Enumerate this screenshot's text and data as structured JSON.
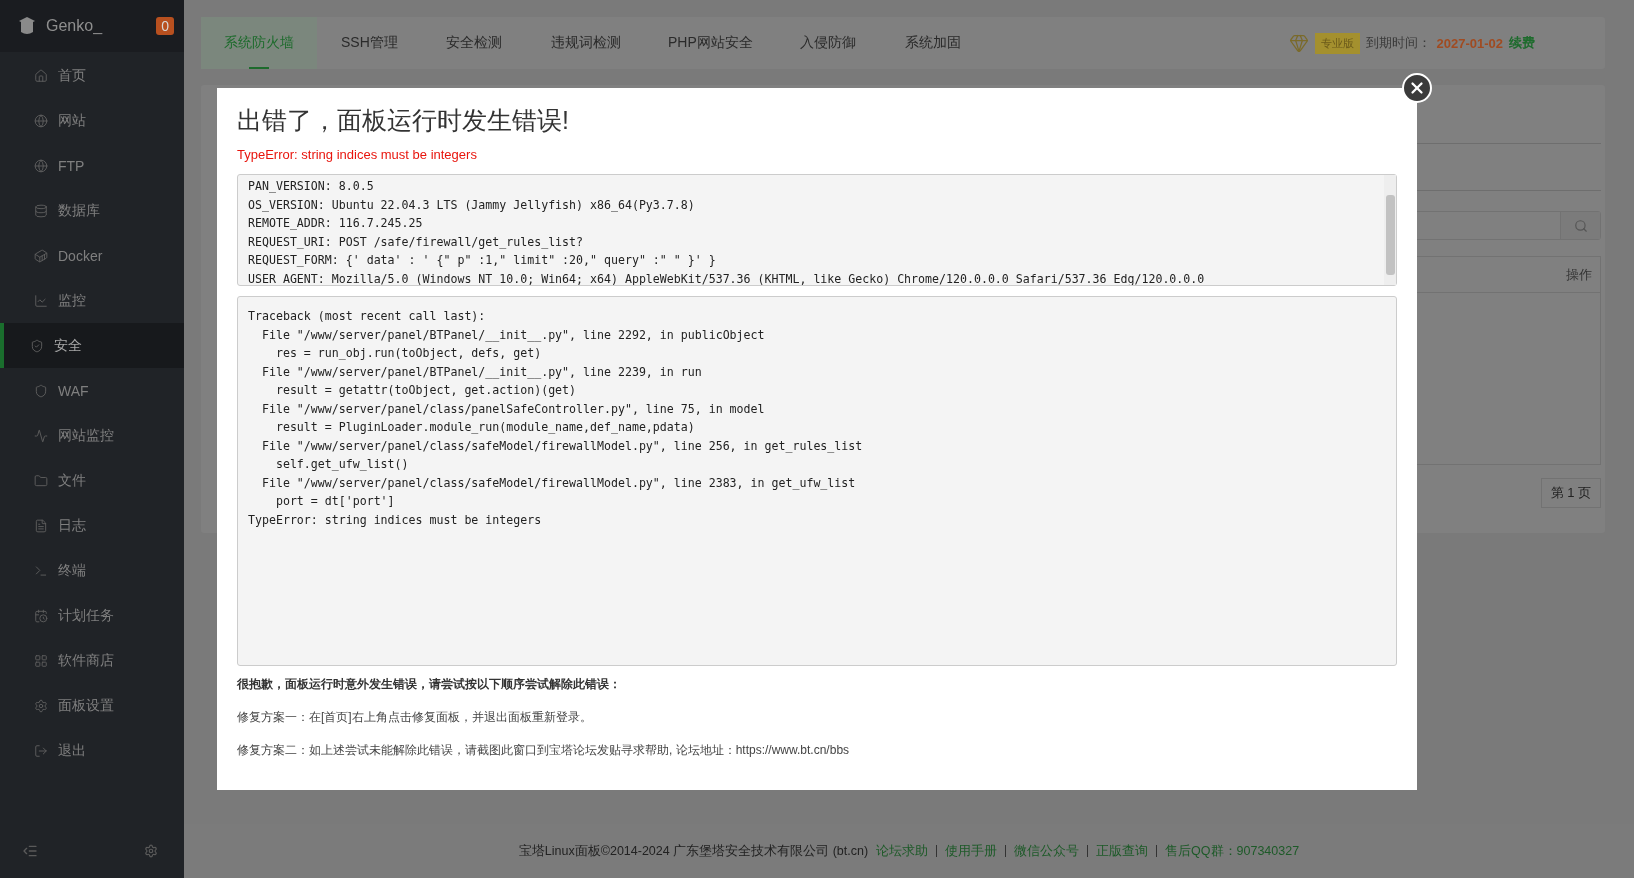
{
  "sidebar": {
    "brand": "Genko_",
    "badge": "0",
    "items": [
      {
        "label": "首页",
        "selected": false
      },
      {
        "label": "网站",
        "selected": false
      },
      {
        "label": "FTP",
        "selected": false
      },
      {
        "label": "数据库",
        "selected": false
      },
      {
        "label": "Docker",
        "selected": false
      },
      {
        "label": "监控",
        "selected": false
      },
      {
        "label": "安全",
        "selected": true
      },
      {
        "label": "WAF",
        "selected": false
      },
      {
        "label": "网站监控",
        "selected": false
      },
      {
        "label": "文件",
        "selected": false
      },
      {
        "label": "日志",
        "selected": false
      },
      {
        "label": "终端",
        "selected": false
      },
      {
        "label": "计划任务",
        "selected": false
      },
      {
        "label": "软件商店",
        "selected": false
      },
      {
        "label": "面板设置",
        "selected": false
      },
      {
        "label": "退出",
        "selected": false
      }
    ]
  },
  "tabs": [
    {
      "label": "系统防火墙",
      "selected": true
    },
    {
      "label": "SSH管理",
      "selected": false
    },
    {
      "label": "安全检测",
      "selected": false
    },
    {
      "label": "违规词检测",
      "selected": false
    },
    {
      "label": "PHP网站安全",
      "selected": false
    },
    {
      "label": "入侵防御",
      "selected": false
    },
    {
      "label": "系统加固",
      "selected": false
    }
  ],
  "plan": {
    "badge": "专业版",
    "expiry_label": "到期时间：",
    "expiry_date": "2027-01-02",
    "renew": "续费"
  },
  "background_table": {
    "columns": [
      "操作"
    ],
    "pager": "第 1 页"
  },
  "dialog": {
    "title": "出错了，面板运行时发生错误!",
    "error": "TypeError: string indices must be integers",
    "env_lines": [
      "PAN_VERSION: 8.0.5",
      "OS_VERSION: Ubuntu 22.04.3 LTS (Jammy Jellyfish) x86_64(Py3.7.8)",
      "REMOTE_ADDR: 116.7.245.25",
      "REQUEST_URI: POST /safe/firewall/get_rules_list?",
      "REQUEST_FORM: {' data' : ' {\" p\" :1,\" limit\" :20,\" query\" :\" \" }' }",
      "USER_AGENT: Mozilla/5.0 (Windows NT 10.0; Win64; x64) AppleWebKit/537.36 (KHTML, like Gecko) Chrome/120.0.0.0 Safari/537.36 Edg/120.0.0.0"
    ],
    "traceback": [
      "Traceback (most recent call last):",
      "  File \"/www/server/panel/BTPanel/__init__.py\", line 2292, in publicObject",
      "    res = run_obj.run(toObject, defs, get)",
      "  File \"/www/server/panel/BTPanel/__init__.py\", line 2239, in run",
      "    result = getattr(toObject, get.action)(get)",
      "  File \"/www/server/panel/class/panelSafeController.py\", line 75, in model",
      "    result = PluginLoader.module_run(module_name,def_name,pdata)",
      "  File \"/www/server/panel/class/safeModel/firewallModel.py\", line 256, in get_rules_list",
      "    self.get_ufw_list()",
      "  File \"/www/server/panel/class/safeModel/firewallModel.py\", line 2383, in get_ufw_list",
      "    port = dt['port']",
      "TypeError: string indices must be integers"
    ],
    "help_heading": "很抱歉，面板运行时意外发生错误，请尝试按以下顺序尝试解除此错误：",
    "help_steps": [
      "修复方案一：在[首页]右上角点击修复面板，并退出面板重新登录。",
      "修复方案二：如上述尝试未能解除此错误，请截图此窗口到宝塔论坛发贴寻求帮助, 论坛地址：https://www.bt.cn/bbs"
    ]
  },
  "footer": {
    "copyright": "宝塔Linux面板©2014-2024 广东堡塔安全技术有限公司 (bt.cn)",
    "links": [
      "论坛求助",
      "使用手册",
      "微信公众号",
      "正版查询",
      "售后QQ群：907340327"
    ]
  }
}
